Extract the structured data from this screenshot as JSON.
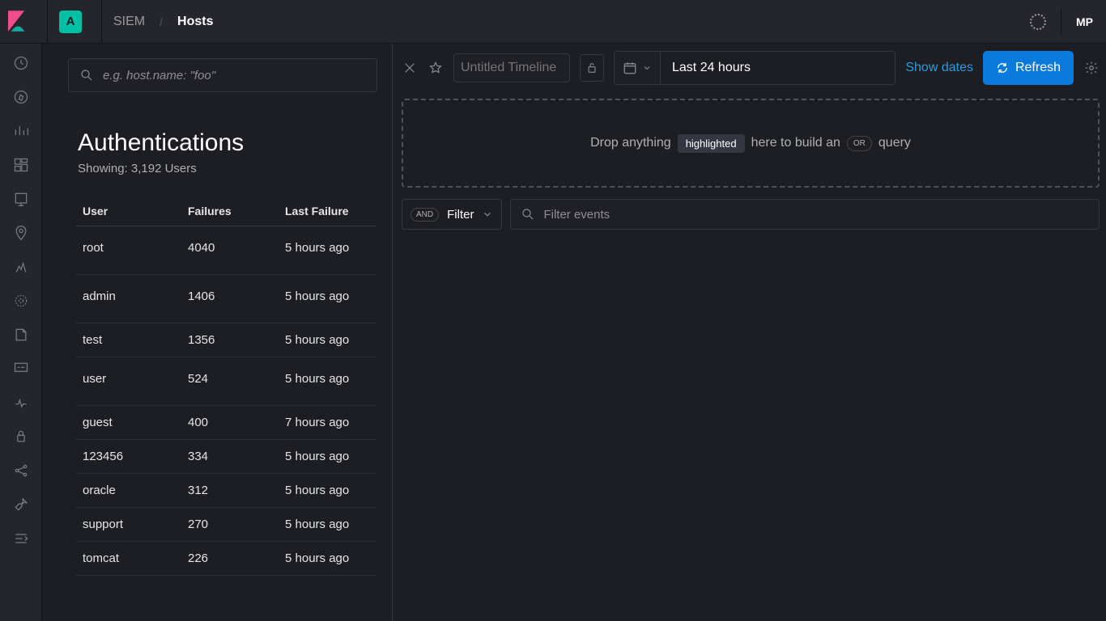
{
  "header": {
    "space_letter": "A",
    "breadcrumbs": [
      "SIEM",
      "Hosts"
    ],
    "user_initials": "MP"
  },
  "left": {
    "search_placeholder": "e.g. host.name: \"foo\"",
    "title": "Authentications",
    "subtitle": "Showing: 3,192 Users",
    "columns": {
      "user": "User",
      "failures": "Failures",
      "last_failure": "Last Failure"
    },
    "rows": [
      {
        "user": "root",
        "failures": "4040",
        "last": "5 hours ago",
        "tall": true
      },
      {
        "user": "admin",
        "failures": "1406",
        "last": "5 hours ago",
        "tall": true
      },
      {
        "user": "test",
        "failures": "1356",
        "last": "5 hours ago"
      },
      {
        "user": "user",
        "failures": "524",
        "last": "5 hours ago",
        "tall": true
      },
      {
        "user": "guest",
        "failures": "400",
        "last": "7 hours ago"
      },
      {
        "user": "123456",
        "failures": "334",
        "last": "5 hours ago"
      },
      {
        "user": "oracle",
        "failures": "312",
        "last": "5 hours ago"
      },
      {
        "user": "support",
        "failures": "270",
        "last": "5 hours ago"
      },
      {
        "user": "tomcat",
        "failures": "226",
        "last": "5 hours ago"
      }
    ]
  },
  "timeline": {
    "title_placeholder": "Untitled Timeline",
    "date_range": "Last 24 hours",
    "show_dates": "Show dates",
    "refresh": "Refresh",
    "drop_prefix": "Drop anything",
    "drop_highlight": "highlighted",
    "drop_mid": "here to build an",
    "drop_or": "OR",
    "drop_suffix": "query",
    "and_label": "AND",
    "filter_label": "Filter",
    "filter_events_placeholder": "Filter events"
  },
  "colors": {
    "accent": "#0a7bdc",
    "link": "#2c9cdb",
    "teal": "#00bfa5"
  }
}
